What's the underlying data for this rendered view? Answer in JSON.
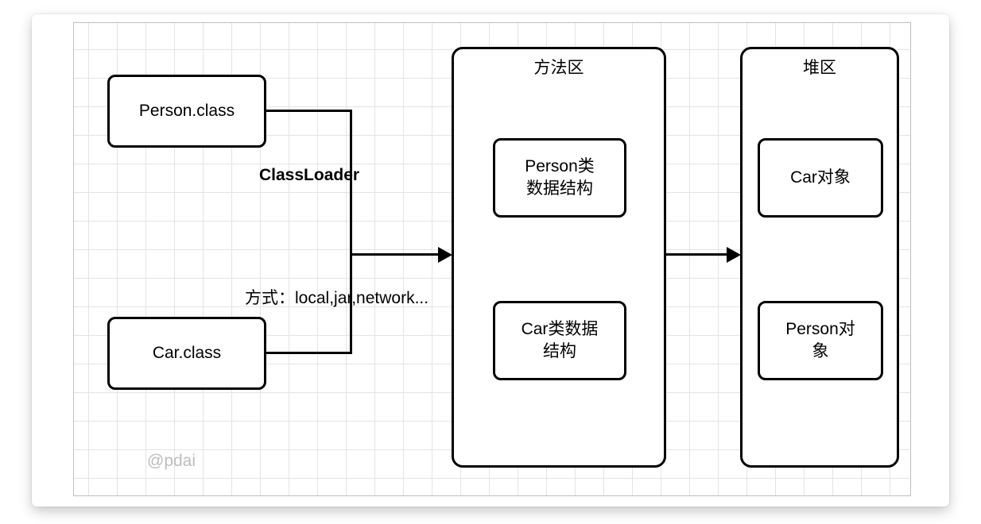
{
  "files": {
    "person": "Person.class",
    "car": "Car.class"
  },
  "loader": {
    "label": "ClassLoader",
    "modes": "方式：local,jar,network..."
  },
  "methodArea": {
    "title": "方法区",
    "personStruct": "Person类\n数据结构",
    "carStruct": "Car类数据\n结构"
  },
  "heapArea": {
    "title": "堆区",
    "carObj": "Car对象",
    "personObj": "Person对\n象"
  },
  "watermark": "@pdai"
}
